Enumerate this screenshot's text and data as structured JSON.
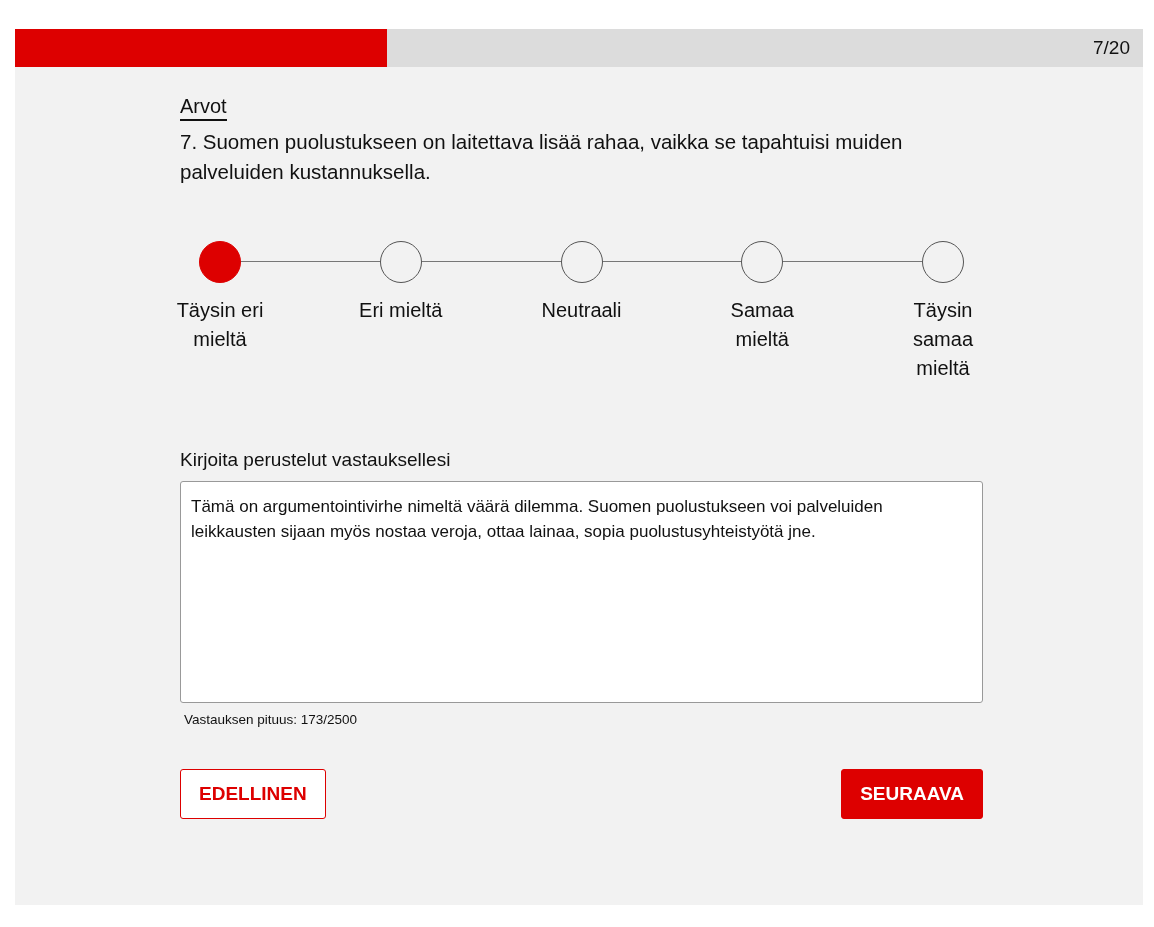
{
  "progress": {
    "level": 0.33,
    "counter": "7/20"
  },
  "category": "Arvot",
  "question": "7. Suomen puolustukseen on laitettava lisää rahaa, vaikka se tapahtuisi muiden palveluiden kustannuksella.",
  "scale": [
    {
      "label": "Täysin eri mieltä",
      "selected": true
    },
    {
      "label": "Eri mieltä",
      "selected": false
    },
    {
      "label": "Neutraali",
      "selected": false
    },
    {
      "label": "Samaa mieltä",
      "selected": false
    },
    {
      "label": "Täysin samaa mieltä",
      "selected": false
    }
  ],
  "answer": {
    "label": "Kirjoita perustelut vastauksellesi",
    "value": "Tämä on argumentointivirhe nimeltä väärä dilemma. Suomen puolustukseen voi palveluiden leikkausten sijaan myös nostaa veroja, ottaa lainaa, sopia puolustusyhteistyötä jne.",
    "length": "Vastauksen pituus: 173/2500"
  },
  "buttons": [
    {
      "label": "EDELLINEN",
      "kind": "secondary"
    },
    {
      "label": "SEURAAVA",
      "kind": "primary"
    }
  ]
}
